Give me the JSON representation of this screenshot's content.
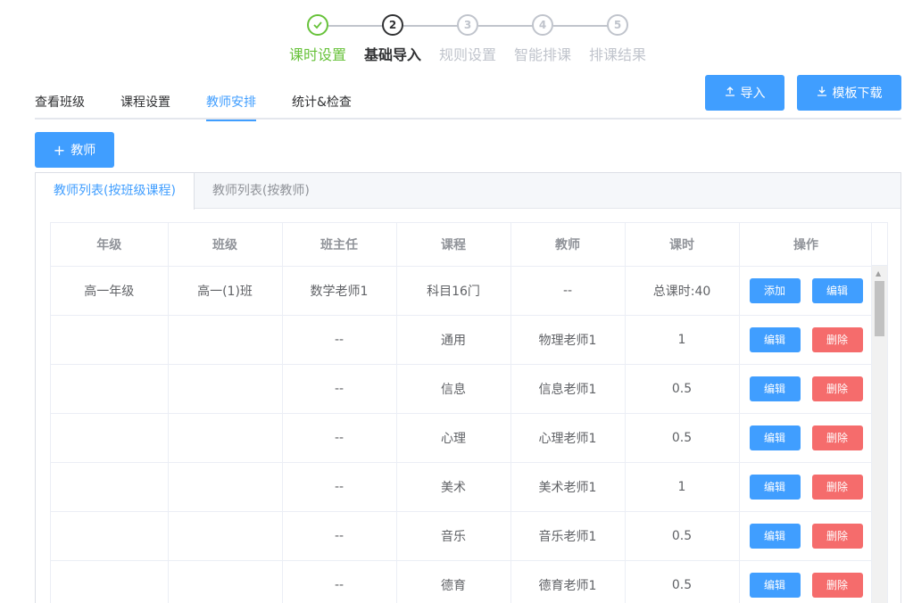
{
  "steps": [
    {
      "num": "1",
      "label": "课时设置",
      "state": "done"
    },
    {
      "num": "2",
      "label": "基础导入",
      "state": "active"
    },
    {
      "num": "3",
      "label": "规则设置",
      "state": "pending"
    },
    {
      "num": "4",
      "label": "智能排课",
      "state": "pending"
    },
    {
      "num": "5",
      "label": "排课结果",
      "state": "pending"
    }
  ],
  "nav": {
    "tabs": [
      "查看班级",
      "课程设置",
      "教师安排",
      "统计&检查"
    ],
    "active_index": 2
  },
  "toolbar": {
    "import_label": "导入",
    "template_download_label": "模板下载",
    "add_teacher_label": "教师"
  },
  "panel": {
    "tabs": [
      "教师列表(按班级课程)",
      "教师列表(按教师)"
    ],
    "active_index": 0
  },
  "table": {
    "columns": [
      "年级",
      "班级",
      "班主任",
      "课程",
      "教师",
      "课时",
      "操作"
    ],
    "rows": [
      {
        "grade": "高一年级",
        "class": "高一(1)班",
        "head_teacher": "数学老师1",
        "course": "科目16门",
        "teacher": "--",
        "hours": "总课时:40",
        "actions": [
          "添加",
          "编辑"
        ]
      },
      {
        "grade": "",
        "class": "",
        "head_teacher": "--",
        "course": "通用",
        "teacher": "物理老师1",
        "hours": "1",
        "actions": [
          "编辑",
          "删除"
        ]
      },
      {
        "grade": "",
        "class": "",
        "head_teacher": "--",
        "course": "信息",
        "teacher": "信息老师1",
        "hours": "0.5",
        "actions": [
          "编辑",
          "删除"
        ]
      },
      {
        "grade": "",
        "class": "",
        "head_teacher": "--",
        "course": "心理",
        "teacher": "心理老师1",
        "hours": "0.5",
        "actions": [
          "编辑",
          "删除"
        ]
      },
      {
        "grade": "",
        "class": "",
        "head_teacher": "--",
        "course": "美术",
        "teacher": "美术老师1",
        "hours": "1",
        "actions": [
          "编辑",
          "删除"
        ]
      },
      {
        "grade": "",
        "class": "",
        "head_teacher": "--",
        "course": "音乐",
        "teacher": "音乐老师1",
        "hours": "0.5",
        "actions": [
          "编辑",
          "删除"
        ]
      },
      {
        "grade": "",
        "class": "",
        "head_teacher": "--",
        "course": "德育",
        "teacher": "德育老师1",
        "hours": "0.5",
        "actions": [
          "编辑",
          "删除"
        ]
      }
    ]
  },
  "colors": {
    "primary": "#409eff",
    "success": "#67c23a",
    "danger": "#f56c6c"
  },
  "icons": {
    "check": "check-icon",
    "upload": "upload-icon",
    "download": "download-icon",
    "plus": "plus-icon"
  }
}
